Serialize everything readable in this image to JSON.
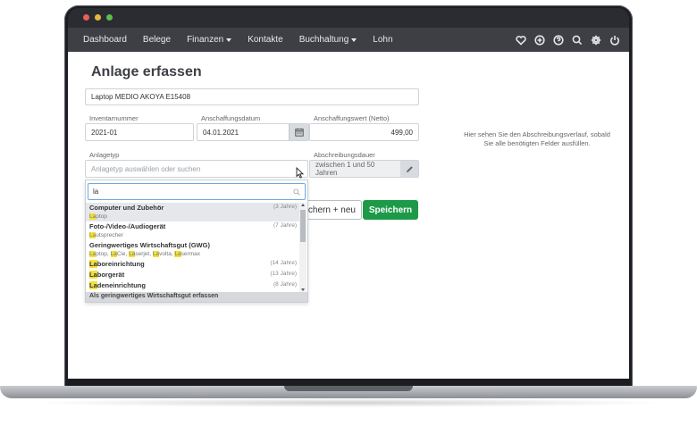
{
  "nav": {
    "items": [
      {
        "label": "Dashboard",
        "has_caret": false
      },
      {
        "label": "Belege",
        "has_caret": false
      },
      {
        "label": "Finanzen",
        "has_caret": true
      },
      {
        "label": "Kontakte",
        "has_caret": false
      },
      {
        "label": "Buchhaltung",
        "has_caret": true
      },
      {
        "label": "Lohn",
        "has_caret": false
      }
    ],
    "icons": [
      "heart-icon",
      "plus-circle-icon",
      "help-icon",
      "search-icon",
      "gear-icon",
      "power-icon"
    ]
  },
  "page": {
    "title": "Anlage erfassen"
  },
  "form": {
    "name_value": "Laptop MEDIO AKOYA E15408",
    "inventory_label": "Inventarnummer",
    "inventory_value": "2021-01",
    "date_label": "Anschaffungsdatum",
    "date_value": "04.01.2021",
    "value_label": "Anschaffungswert (Netto)",
    "value_value": "499,00",
    "type_label": "Anlagetyp",
    "type_placeholder": "Anlagetyp auswählen oder suchen",
    "duration_label": "Abschreibungsdauer",
    "duration_value": "zwischen 1 und 50 Jahren"
  },
  "buttons": {
    "save_new": "Speichern + neu",
    "save": "Speichern"
  },
  "info": {
    "text": "Hier sehen Sie den Abschreibungsverlauf, sobald Sie alle benötigten Felder ausfüllen."
  },
  "dropdown": {
    "search_value": "la",
    "footer": "Als geringwertiges Wirtschaftsgut erfassen"
  },
  "colors": {
    "nav_bg": "#3d3f44",
    "save_green": "#1d9a48",
    "highlight": "#f2e03a"
  }
}
